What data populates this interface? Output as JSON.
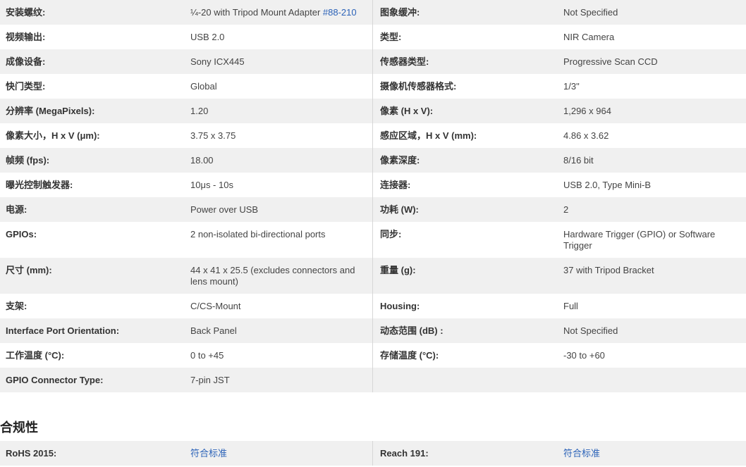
{
  "specs": [
    {
      "l1": "安装螺纹:",
      "v1": "¼-20 with Tripod Mount Adapter ",
      "v1_link": "#88-210",
      "l2": "图象缓冲:",
      "v2": "Not Specified"
    },
    {
      "l1": "视频输出:",
      "v1": "USB 2.0",
      "l2": "类型:",
      "v2": "NIR Camera"
    },
    {
      "l1": "成像设备:",
      "v1": "Sony ICX445",
      "l2": "传感器类型:",
      "v2": "Progressive Scan CCD"
    },
    {
      "l1": "快门类型:",
      "v1": "Global",
      "l2": "摄像机传感器格式:",
      "v2": "1/3\""
    },
    {
      "l1": "分辨率 (MegaPixels):",
      "v1": "1.20",
      "l2": "像素 (H x V):",
      "v2": "1,296 x 964"
    },
    {
      "l1": "像素大小，H x V (μm):",
      "v1": "3.75 x 3.75",
      "l2": "感应区域，H x V (mm):",
      "v2": "4.86 x 3.62"
    },
    {
      "l1": "帧频 (fps):",
      "v1": "18.00",
      "l2": "像素深度:",
      "v2": "8/16 bit"
    },
    {
      "l1": "曝光控制触发器:",
      "v1": "10μs - 10s",
      "l2": "连接器:",
      "v2": "USB 2.0, Type Mini-B"
    },
    {
      "l1": "电源:",
      "v1": "Power over USB",
      "l2": "功耗 (W):",
      "v2": "2"
    },
    {
      "l1": "GPIOs:",
      "v1": "2 non-isolated bi-directional ports",
      "l2": "同步:",
      "v2": "Hardware Trigger (GPIO) or Software Trigger"
    },
    {
      "l1": "尺寸 (mm):",
      "v1": "44 x 41 x 25.5 (excludes connectors and lens mount)",
      "l2": "重量 (g):",
      "v2": "37 with Tripod Bracket"
    },
    {
      "l1": "支架:",
      "v1": "C/CS-Mount",
      "l2": "Housing:",
      "v2": "Full"
    },
    {
      "l1": "Interface Port Orientation:",
      "v1": "Back Panel",
      "l2": "动态范围 (dB) :",
      "v2": "Not Specified"
    },
    {
      "l1": "工作温度 (°C):",
      "v1": "0 to +45",
      "l2": "存储温度 (°C):",
      "v2": "-30 to +60"
    },
    {
      "l1": "GPIO Connector Type:",
      "v1": "7-pin JST",
      "l2": "",
      "v2": ""
    }
  ],
  "compliance": {
    "title": "合规性",
    "rows": [
      {
        "l1": "RoHS 2015:",
        "v1_link": "符合标准",
        "l2": "Reach 191:",
        "v2_link": "符合标准"
      }
    ]
  },
  "colors": {
    "link": "#2b62b8",
    "row_shade": "#f0f0f0"
  }
}
